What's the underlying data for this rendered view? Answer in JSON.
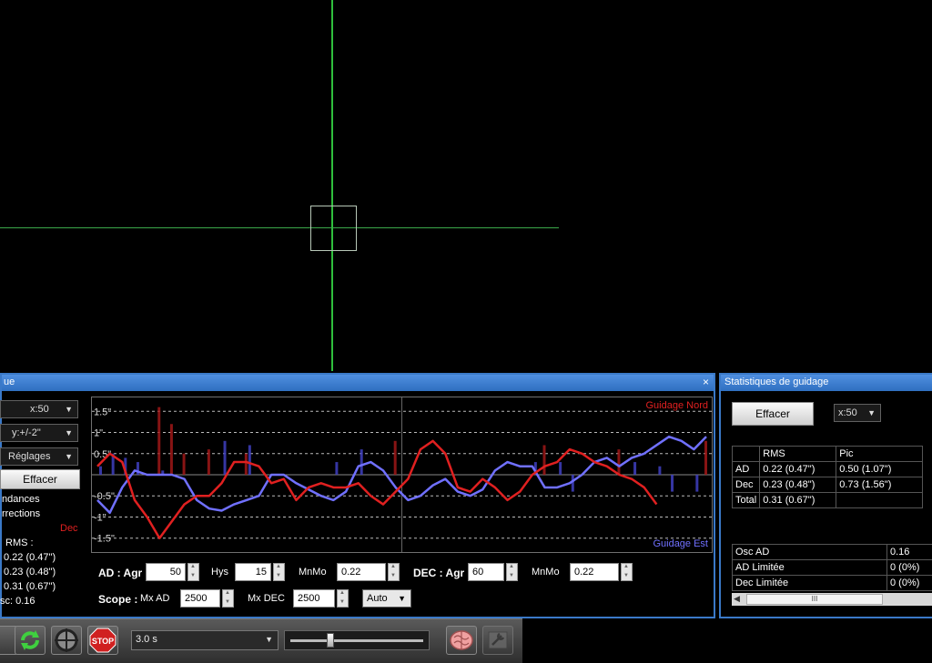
{
  "graph_window": {
    "title": "ue",
    "close": "×",
    "x_scale": "x:50",
    "y_scale": "y:+/-2\"",
    "settings_label": "Réglages",
    "clear_label": "Effacer",
    "trends_label": "ndances",
    "corrections_label": "rrections",
    "dec_label": "Dec",
    "rms_label": "RMS :",
    "rms_ra": "0.22 (0.47\")",
    "rms_dec": "0.23 (0.48\")",
    "rms_total": "0.31 (0.67\")",
    "osc": "sc: 0.16",
    "north_label": "Guidage Nord",
    "east_label": "Guidage Est",
    "y_ticks": [
      "1.5\"",
      "1\"",
      "0.5\"",
      "-0.5\"",
      "-1\"",
      "-1.5\""
    ],
    "ra_agr_label": "AD : Agr",
    "ra_agr": "50",
    "hys_label": "Hys",
    "hys": "15",
    "ra_mnmo_label": "MnMo",
    "ra_mnmo": "0.22",
    "dec_agr_label": "DEC : Agr",
    "dec_agr": "60",
    "dec_mnmo_label": "MnMo",
    "dec_mnmo": "0.22",
    "scope_label": "Scope :",
    "mx_ad_label": "Mx AD",
    "mx_ad": "2500",
    "mx_dec_label": "Mx DEC",
    "mx_dec": "2500",
    "auto": "Auto"
  },
  "stats_window": {
    "title": "Statistiques de guidage",
    "clear_label": "Effacer",
    "x_scale": "x:50",
    "headers": [
      "",
      "RMS",
      "Pic"
    ],
    "rows": [
      [
        "AD",
        "0.22 (0.47\")",
        "0.50 (1.07\")"
      ],
      [
        "Dec",
        "0.23 (0.48\")",
        "0.73 (1.56\")"
      ],
      [
        "Total",
        "0.31 (0.67\")",
        ""
      ]
    ],
    "extra_rows": [
      [
        "Osc AD",
        "0.16"
      ],
      [
        "AD Limitée",
        "0 (0%)"
      ],
      [
        "Dec Limitée",
        "0 (0%)"
      ]
    ],
    "scroll_label": "III"
  },
  "toolbar": {
    "exposure": "3.0 s",
    "stop_label": "STOP"
  },
  "colors": {
    "ra_line": "#7070ff",
    "dec_line": "#e02020",
    "crosshair": "#2fbf3c",
    "title_bar": "#3a79c8"
  },
  "chart_data": {
    "type": "line",
    "ylim": [
      -1.7,
      1.7
    ],
    "x": [
      0,
      1,
      2,
      3,
      4,
      5,
      6,
      7,
      8,
      9,
      10,
      11,
      12,
      13,
      14,
      15,
      16,
      17,
      18,
      19,
      20,
      21,
      22,
      23,
      24,
      25,
      26,
      27,
      28,
      29,
      30,
      31,
      32,
      33,
      34,
      35,
      36,
      37,
      38,
      39,
      40,
      41,
      42,
      43,
      44,
      45,
      46,
      47,
      48,
      49
    ],
    "series": [
      {
        "name": "AD",
        "color": "#7070ff",
        "values": [
          -0.6,
          -0.9,
          -0.3,
          0.1,
          0.0,
          0.0,
          0.0,
          -0.1,
          -0.6,
          -0.8,
          -0.85,
          -0.7,
          -0.6,
          -0.5,
          0.0,
          0.0,
          -0.2,
          -0.35,
          -0.5,
          -0.6,
          -0.4,
          0.2,
          0.3,
          0.1,
          -0.3,
          -0.6,
          -0.5,
          -0.25,
          -0.1,
          -0.4,
          -0.5,
          -0.35,
          0.1,
          0.3,
          0.2,
          0.2,
          -0.3,
          -0.3,
          -0.2,
          0.0,
          0.3,
          0.4,
          0.2,
          0.4,
          0.5,
          0.7,
          0.9,
          0.8,
          0.6,
          0.9
        ]
      },
      {
        "name": "Dec",
        "color": "#e02020",
        "values": [
          0.2,
          0.5,
          0.3,
          -0.6,
          -1.0,
          -1.5,
          -1.1,
          -0.7,
          -0.5,
          -0.5,
          -0.2,
          0.3,
          0.3,
          0.2,
          -0.2,
          -0.1,
          -0.6,
          -0.3,
          -0.2,
          -0.3,
          -0.3,
          -0.2,
          -0.5,
          -0.7,
          -0.4,
          -0.1,
          0.6,
          0.8,
          0.5,
          -0.3,
          -0.4,
          -0.1,
          -0.3,
          -0.6,
          -0.4,
          0.0,
          0.2,
          0.3,
          0.6,
          0.5,
          0.3,
          0.2,
          0.0,
          -0.1,
          -0.3,
          -0.7
        ]
      }
    ],
    "corrections": {
      "ra": [
        0.2,
        0.5,
        0.4,
        0.3,
        0.0,
        0.1,
        0.0,
        0.0,
        0.0,
        0.0,
        0.8,
        0.0,
        0.7,
        0.0,
        0.0,
        0.0,
        0.0,
        0.0,
        0.0,
        0.3,
        0.0,
        0.6,
        0.0,
        0.0,
        0.0,
        0.0,
        0.0,
        0.0,
        0.0,
        0.0,
        0.0,
        0.0,
        0.0,
        0.0,
        0.0,
        0.3,
        0.0,
        0.3,
        -0.4,
        0.0,
        0.0,
        0.0,
        0.0,
        0.3,
        0.0,
        0.2,
        -0.4,
        0.0,
        -0.4,
        0.0
      ],
      "dec": [
        0.0,
        0.0,
        0.0,
        0.0,
        0.0,
        1.6,
        1.2,
        0.5,
        0.0,
        0.6,
        0.0,
        0.0,
        0.5,
        0.0,
        0.0,
        0.0,
        0.0,
        0.0,
        0.0,
        0.0,
        0.0,
        0.0,
        0.0,
        0.0,
        0.8,
        0.0,
        0.0,
        0.0,
        0.0,
        0.0,
        0.0,
        0.0,
        0.0,
        0.0,
        0.0,
        0.0,
        0.7,
        0.0,
        0.0,
        0.0,
        0.0,
        0.0,
        0.6,
        0.0,
        0.0,
        0.0,
        0.0,
        0.0,
        0.0,
        0.8
      ]
    }
  }
}
